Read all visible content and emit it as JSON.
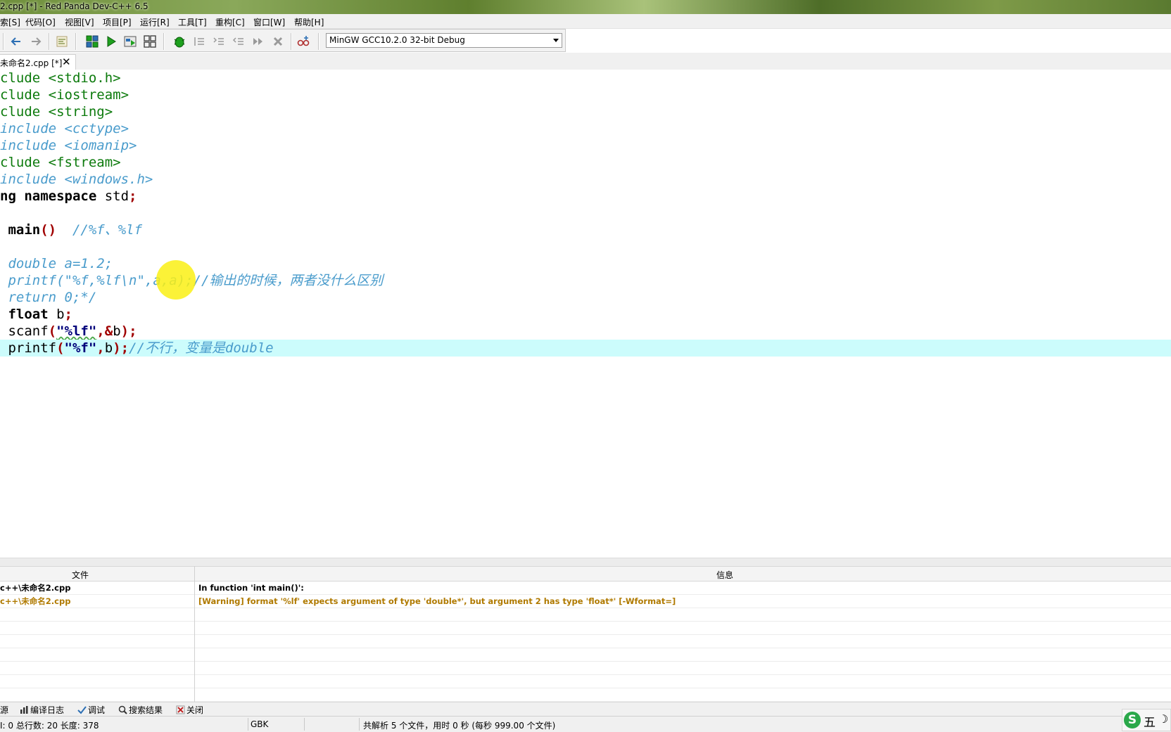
{
  "window": {
    "title": "2.cpp [*] - Red Panda Dev-C++ 6.5"
  },
  "menu": [
    {
      "label": "索[S]"
    },
    {
      "label": "代码[O]"
    },
    {
      "label": "视图[V]"
    },
    {
      "label": "项目[P]"
    },
    {
      "label": "运行[R]"
    },
    {
      "label": "工具[T]"
    },
    {
      "label": "重构[C]"
    },
    {
      "label": "窗口[W]"
    },
    {
      "label": "帮助[H]"
    }
  ],
  "toolbar": {
    "compiler": "MinGW GCC10.2.0 32-bit Debug",
    "icons": [
      "back-arrow-icon",
      "forward-arrow-icon",
      "code-format-icon",
      "compile-icon",
      "run-icon",
      "compile-run-icon",
      "rebuild-icon",
      "debug-icon",
      "step-over-icon",
      "step-into-icon",
      "step-out-icon",
      "continue-icon",
      "stop-icon",
      "add-watch-icon"
    ],
    "colors": {
      "green": "#1ea01e",
      "gray": "#9a9a9a",
      "blue": "#2c6fb4"
    }
  },
  "tabs": [
    {
      "label": "未命名2.cpp [*]",
      "close": "✕"
    }
  ],
  "editor": {
    "lines": [
      [
        {
          "t": "clude <stdio.h>",
          "c": "inc"
        }
      ],
      [
        {
          "t": "clude <iostream>",
          "c": "inc"
        }
      ],
      [
        {
          "t": "clude <string>",
          "c": "inc"
        }
      ],
      [
        {
          "t": "include <cctype>",
          "c": "cm"
        }
      ],
      [
        {
          "t": "include <iomanip>",
          "c": "cm"
        }
      ],
      [
        {
          "t": "clude <fstream>",
          "c": "inc"
        }
      ],
      [
        {
          "t": "include <windows.h>",
          "c": "cm"
        }
      ],
      [
        {
          "t": "ng namespace ",
          "c": "kw"
        },
        {
          "t": "std",
          "c": "id"
        },
        {
          "t": ";",
          "c": "pn"
        }
      ],
      [],
      [
        {
          "t": " main",
          "c": "kw"
        },
        {
          "t": "()",
          "c": "pn"
        },
        {
          "t": "  //%f、%lf",
          "c": "cm"
        }
      ],
      [],
      [
        {
          "t": " double a=1.2;",
          "c": "cm"
        }
      ],
      [
        {
          "t": " printf(\"%f,%lf\\n\",a,a);//输出的时候，两者没什么区别",
          "c": "cm"
        }
      ],
      [
        {
          "t": " return 0;*/",
          "c": "cm"
        }
      ],
      [
        {
          "t": " float ",
          "c": "kw"
        },
        {
          "t": "b",
          "c": "id"
        },
        {
          "t": ";",
          "c": "pn"
        }
      ],
      [
        {
          "t": " scanf",
          "c": "id"
        },
        {
          "t": "(",
          "c": "pn"
        },
        {
          "t": "\"%lf\"",
          "c": "str sq"
        },
        {
          "t": ",&",
          "c": "pn"
        },
        {
          "t": "b",
          "c": "id"
        },
        {
          "t": ");",
          "c": "pn"
        }
      ],
      [
        {
          "t": " printf",
          "c": "id"
        },
        {
          "t": "(",
          "c": "pn"
        },
        {
          "t": "\"%f\"",
          "c": "str"
        },
        {
          "t": ",",
          "c": "pn"
        },
        {
          "t": "b",
          "c": "id"
        },
        {
          "t": ");",
          "c": "pn"
        },
        {
          "t": "//不行，变量是double",
          "c": "cm"
        }
      ]
    ],
    "highlight_line": 16
  },
  "messages": {
    "headers": {
      "file": "文件",
      "info": "信息"
    },
    "rows": [
      {
        "file": "c++\\未命名2.cpp",
        "msg": "In function 'int main()':",
        "kind": "info"
      },
      {
        "file": "c++\\未命名2.cpp",
        "msg": "[Warning] format '%lf' expects argument of type 'double*', but argument 2 has type 'float*' [-Wformat=]",
        "kind": "warning"
      }
    ],
    "empty_rows": 7
  },
  "bottom_tabs": [
    {
      "label": "源",
      "icon": ""
    },
    {
      "label": "编译日志",
      "icon": "compile-log-icon"
    },
    {
      "label": "调试",
      "icon": "debug-check-icon"
    },
    {
      "label": "搜索结果",
      "icon": "search-results-icon"
    },
    {
      "label": "关闭",
      "icon": "close-panel-icon"
    }
  ],
  "status": {
    "segment1": "I:    0  总行数:    20  长度:   378",
    "encoding": "GBK",
    "parse": "共解析 5 个文件，用时 0 秒 (每秒 999.00 个文件)"
  },
  "ime": {
    "logo": "S",
    "mode": "五",
    "moon": "☽"
  }
}
